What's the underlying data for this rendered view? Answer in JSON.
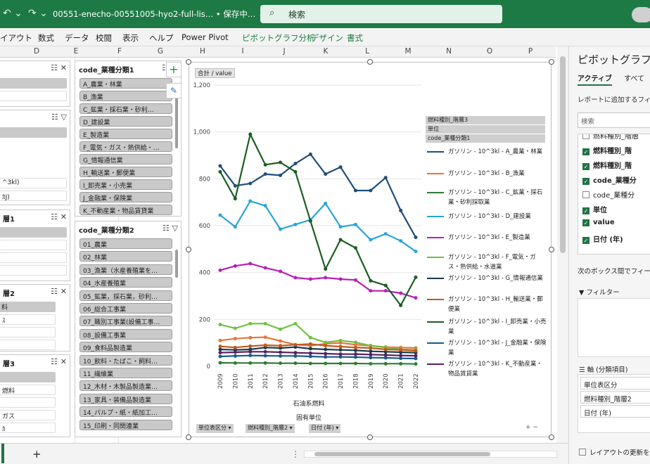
{
  "titlebar": {
    "filename": "00551-enecho-00551005-hyo2-full-lis…  • 保存中… ⌄",
    "search_label": "検索"
  },
  "ribbon_tabs": [
    "イアウト",
    "数式",
    "データ",
    "校閲",
    "表示",
    "ヘルプ",
    "Power Pivot",
    "ピボットグラフ分析",
    "デザイン",
    "書式"
  ],
  "column_headers": [
    "D",
    "E",
    "F",
    "G",
    "H",
    "I",
    "J",
    "K",
    "L",
    "M",
    "N",
    "O",
    "P"
  ],
  "slicers": {
    "left_panels": [
      {
        "title": "",
        "items": [
          "",
          "",
          "",
          "",
          ""
        ]
      },
      {
        "title": "",
        "items": [
          "",
          "",
          "",
          "",
          "",
          "^3kl)",
          "ｶJ)"
        ]
      },
      {
        "title": "層1",
        "items": [
          "",
          "",
          "",
          ""
        ]
      },
      {
        "title": "層2",
        "items": [
          "料",
          "ｽ",
          "",
          "",
          ""
        ]
      },
      {
        "title": "層3",
        "items": [
          "",
          "燃料",
          "",
          "ガス",
          "",
          "ｶ"
        ]
      }
    ],
    "gyoshu1": {
      "title": "code_業種分類1",
      "items": [
        "A_農業・林業",
        "B_漁業",
        "C_鉱業・採石業・砂利…",
        "D_建設業",
        "E_製造業",
        "F_電気・ガス・熱供給・…",
        "G_情報通信業",
        "H_輸送業・郵便業",
        "I_卸売業・小売業",
        "J_金融業・保険業",
        "K_不動産業・物品賃貸業"
      ]
    },
    "gyoshu2": {
      "title": "code_業種分類2",
      "items": [
        "01_農業",
        "02_林業",
        "03_漁業（水産養殖業を…",
        "04_水産養殖業",
        "05_鉱業，採石業，砂利…",
        "06_総合工事業",
        "07_職別工事業(設備工事…",
        "08_設備工事業",
        "09_食料品製造業",
        "10_飲料・たばこ・飼料…",
        "11_繊維業",
        "12_木材・木製品製造業…",
        "13_家具・装備品製造業",
        "14_パルプ・紙・紙加工…",
        "15_印刷・同関連業"
      ]
    }
  },
  "chart": {
    "sum_button": "合計 / value",
    "legend_fields": [
      "燃料種別_階層3",
      "単位",
      "code_業種分類1"
    ],
    "axis_field_buttons": [
      "単位表区分",
      "燃料種別_階層2",
      "日付 (年)"
    ],
    "x_group1": "石油系燃料",
    "x_group2": "固有単位"
  },
  "chart_data": {
    "type": "line",
    "x": [
      "2009",
      "2010",
      "2011",
      "2012",
      "2013",
      "2014",
      "2015",
      "2016",
      "2017",
      "2018",
      "2019",
      "2020",
      "2021",
      "2022"
    ],
    "ylim": [
      0,
      1200
    ],
    "yticks": [
      "0",
      "200",
      "400",
      "600",
      "800",
      "1,000",
      "1,200"
    ],
    "series": [
      {
        "name": "ガソリン - 10^3kl - A_農業・林業",
        "color": "#1f4e79",
        "values": [
          855,
          770,
          780,
          820,
          815,
          865,
          905,
          820,
          850,
          750,
          750,
          805,
          665,
          550
        ]
      },
      {
        "name": "ガソリン - 10^3kl - B_漁業",
        "color": "#e8743b",
        "values": [
          110,
          118,
          122,
          124,
          108,
          92,
          88,
          96,
          100,
          92,
          88,
          82,
          80,
          78
        ]
      },
      {
        "name": "ガソリン - 10^3kl - C_鉱業・採石業・砂利採取業",
        "color": "#2e7d32",
        "values": [
          15,
          14,
          14,
          14,
          13,
          13,
          12,
          12,
          12,
          12,
          11,
          11,
          11,
          10
        ]
      },
      {
        "name": "ガソリン - 10^3kl - D_建設業",
        "color": "#29a3dc",
        "values": [
          645,
          595,
          705,
          685,
          585,
          605,
          625,
          695,
          595,
          605,
          540,
          565,
          535,
          490
        ]
      },
      {
        "name": "ガソリン - 10^3kl - E_製造業",
        "color": "#b620b6",
        "values": [
          410,
          428,
          438,
          420,
          405,
          378,
          372,
          378,
          372,
          368,
          322,
          322,
          312,
          292
        ]
      },
      {
        "name": "ガソリン - 10^3kl - F_電気・ガス・熱供給・水道業",
        "color": "#70c040",
        "values": [
          178,
          162,
          182,
          182,
          158,
          182,
          122,
          102,
          110,
          102,
          88,
          80,
          72,
          70
        ]
      },
      {
        "name": "ガソリン - 10^3kl - G_情報通信業",
        "color": "#1b3a4b",
        "values": [
          72,
          70,
          72,
          80,
          78,
          82,
          75,
          72,
          70,
          68,
          64,
          62,
          60,
          58
        ]
      },
      {
        "name": "ガソリン - 10^3kl - H_輸送業・郵便業",
        "color": "#c0591d",
        "values": [
          85,
          80,
          86,
          90,
          88,
          92,
          95,
          88,
          84,
          80,
          78,
          72,
          70,
          66
        ]
      },
      {
        "name": "ガソリン - 10^3kl - I_卸売業・小売業",
        "color": "#1a5e20",
        "values": [
          830,
          715,
          990,
          860,
          870,
          830,
          620,
          415,
          540,
          505,
          365,
          345,
          260,
          380
        ]
      },
      {
        "name": "ガソリン - 10^3kl - J_金融業・保険業",
        "color": "#185a8c",
        "values": [
          42,
          44,
          46,
          45,
          44,
          44,
          42,
          40,
          40,
          39,
          37,
          36,
          34,
          33
        ]
      },
      {
        "name": "ガソリン - 10^3kl - K_不動産業・物品賃貸業",
        "color": "#5a1e63",
        "values": [
          58,
          60,
          62,
          62,
          60,
          58,
          56,
          54,
          52,
          52,
          50,
          48,
          46,
          45
        ]
      }
    ]
  },
  "field_pane": {
    "title": "ピボットグラフの",
    "tab_active": "アクティブ",
    "tab_all": "すべて",
    "subtitle": "レポートに追加するフィール",
    "search_placeholder": "検索",
    "fields": [
      {
        "label": "燃料種別_階層",
        "checked": false
      },
      {
        "label": "燃料種別_階",
        "checked": true
      },
      {
        "label": "燃料種別_階",
        "checked": true
      },
      {
        "label": "code_業種分",
        "checked": true
      },
      {
        "label": "code_業種分",
        "checked": false
      },
      {
        "label": "単位",
        "checked": true
      },
      {
        "label": "value",
        "checked": true
      },
      {
        "label": "日付 (年)",
        "checked": true
      }
    ],
    "box_note": "次のボックス間でフィールド",
    "filter_label": "フィルター",
    "axis_label": "軸 (分類項目)",
    "axis_items": [
      "単位表区分",
      "燃料種別_階層2",
      "日付 (年)"
    ],
    "defer_label": "レイアウトの更新を保"
  },
  "sheetbar": {
    "add_label": "+",
    "dots": "⋮"
  }
}
